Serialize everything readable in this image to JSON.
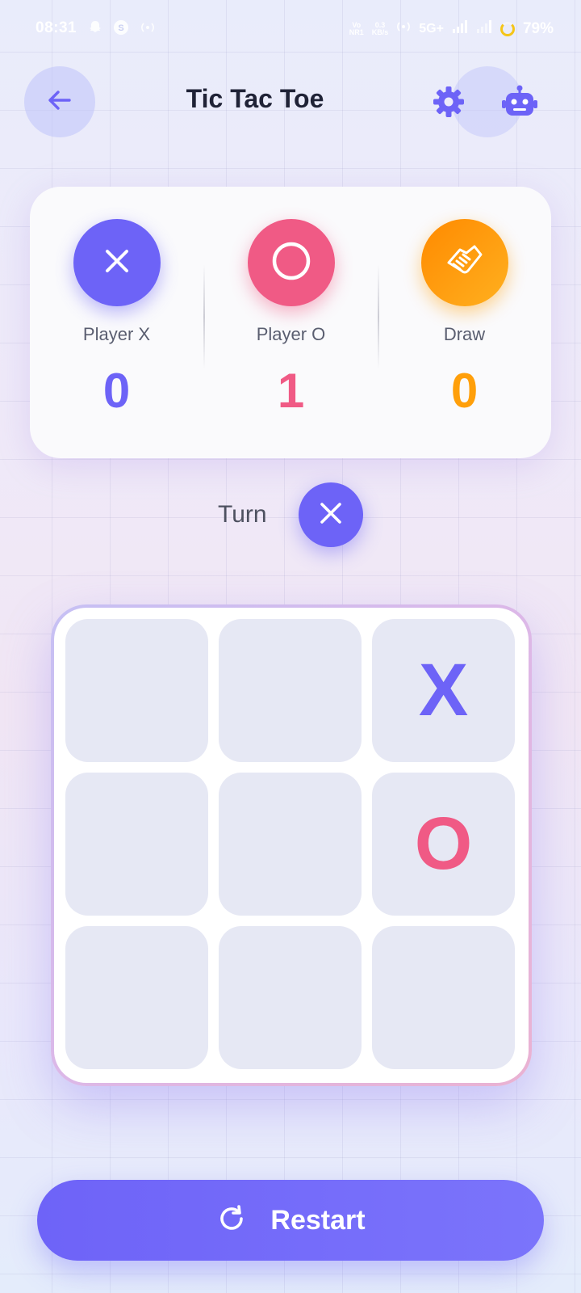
{
  "status_bar": {
    "time": "08:31",
    "network_label": "5G+",
    "speed_value": "0.3",
    "speed_unit": "KB/s",
    "battery": "79%"
  },
  "header": {
    "title": "Tic Tac Toe",
    "back_icon": "arrow-left-icon",
    "settings_icon": "gear-icon",
    "bot_icon": "robot-icon"
  },
  "scores": {
    "player_x": {
      "label": "Player X",
      "value": "0",
      "icon": "x-icon",
      "color": "#6d63f7"
    },
    "player_o": {
      "label": "Player O",
      "value": "1",
      "icon": "circle-icon",
      "color": "#f05a85"
    },
    "draw": {
      "label": "Draw",
      "value": "0",
      "icon": "handshake-icon",
      "color": "#ff9f0a"
    }
  },
  "turn": {
    "label": "Turn",
    "current": "X"
  },
  "board": {
    "cells": [
      "",
      "",
      "X",
      "",
      "",
      "O",
      "",
      "",
      ""
    ]
  },
  "restart": {
    "label": "Restart",
    "icon": "refresh-icon"
  },
  "colors": {
    "accent": "#6d63f7",
    "o_color": "#f05a85",
    "draw_color": "#ff9f0a",
    "cell_bg": "#e6e8f4"
  }
}
